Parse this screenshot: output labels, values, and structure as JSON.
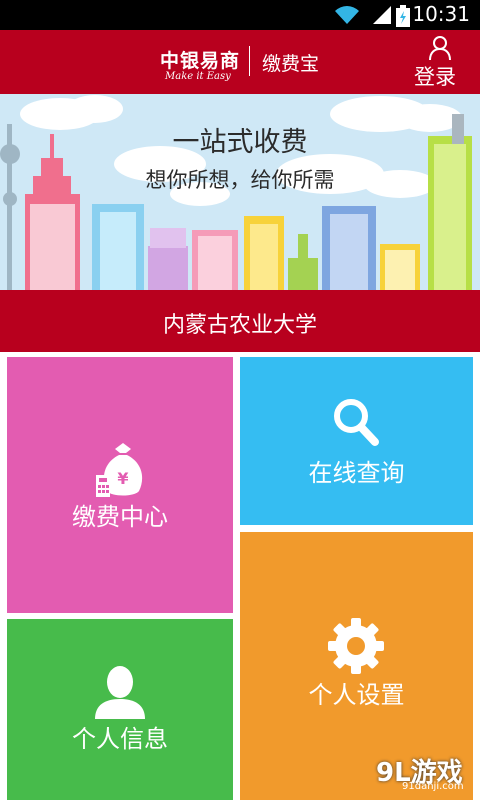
{
  "status_bar": {
    "time": "10:31"
  },
  "header": {
    "logo_cn": "中银易商",
    "logo_en": "Make it Easy",
    "app_name": "缴费宝",
    "login_label": "登录"
  },
  "banner": {
    "title": "一站式收费",
    "subtitle": "想你所想，给你所需"
  },
  "school_name": "内蒙古农业大学",
  "tiles": {
    "pay_center": {
      "label": "缴费中心",
      "color": "#e35cb1"
    },
    "online_query": {
      "label": "在线查询",
      "color": "#35bdf2"
    },
    "personal_info": {
      "label": "个人信息",
      "color": "#47bb4b"
    },
    "personal_settings": {
      "label": "个人设置",
      "color": "#f19a2c"
    }
  },
  "watermark": {
    "brand": "9L游戏",
    "url": "91danji.com"
  },
  "colors": {
    "brand_red": "#b8001e"
  }
}
